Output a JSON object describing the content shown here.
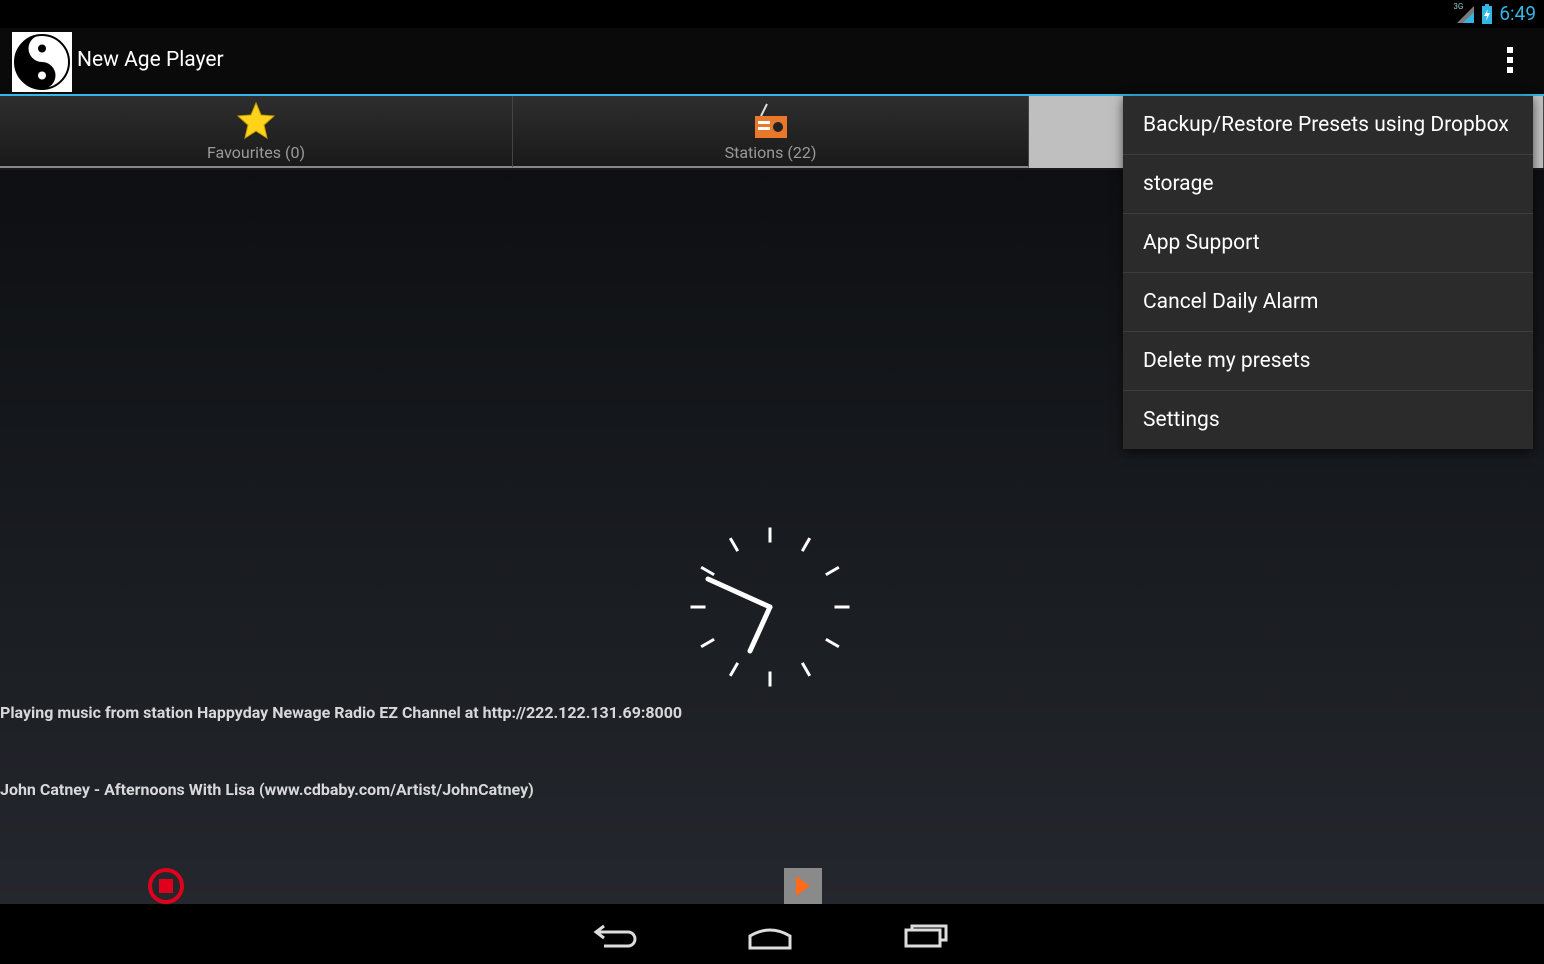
{
  "status": {
    "time": "6:49",
    "network": "3G"
  },
  "app": {
    "title": "New Age Player"
  },
  "tabs": [
    {
      "label": "Favourites (0)",
      "icon": "star-icon"
    },
    {
      "label": "Stations (22)",
      "icon": "radio-icon"
    }
  ],
  "menu": {
    "items": [
      "Backup/Restore Presets using Dropbox",
      "storage",
      "App Support",
      "Cancel Daily Alarm",
      "Delete my presets",
      "Settings"
    ]
  },
  "player": {
    "now_playing": "Playing music from station Happyday Newage Radio EZ Channel at http://222.122.131.69:8000",
    "track": "John Catney - Afternoons With Lisa (www.cdbaby.com/Artist/JohnCatney)"
  },
  "colors": {
    "accent": "#33b5e5",
    "stop": "#e0001b",
    "play": "#ff6a1a"
  }
}
